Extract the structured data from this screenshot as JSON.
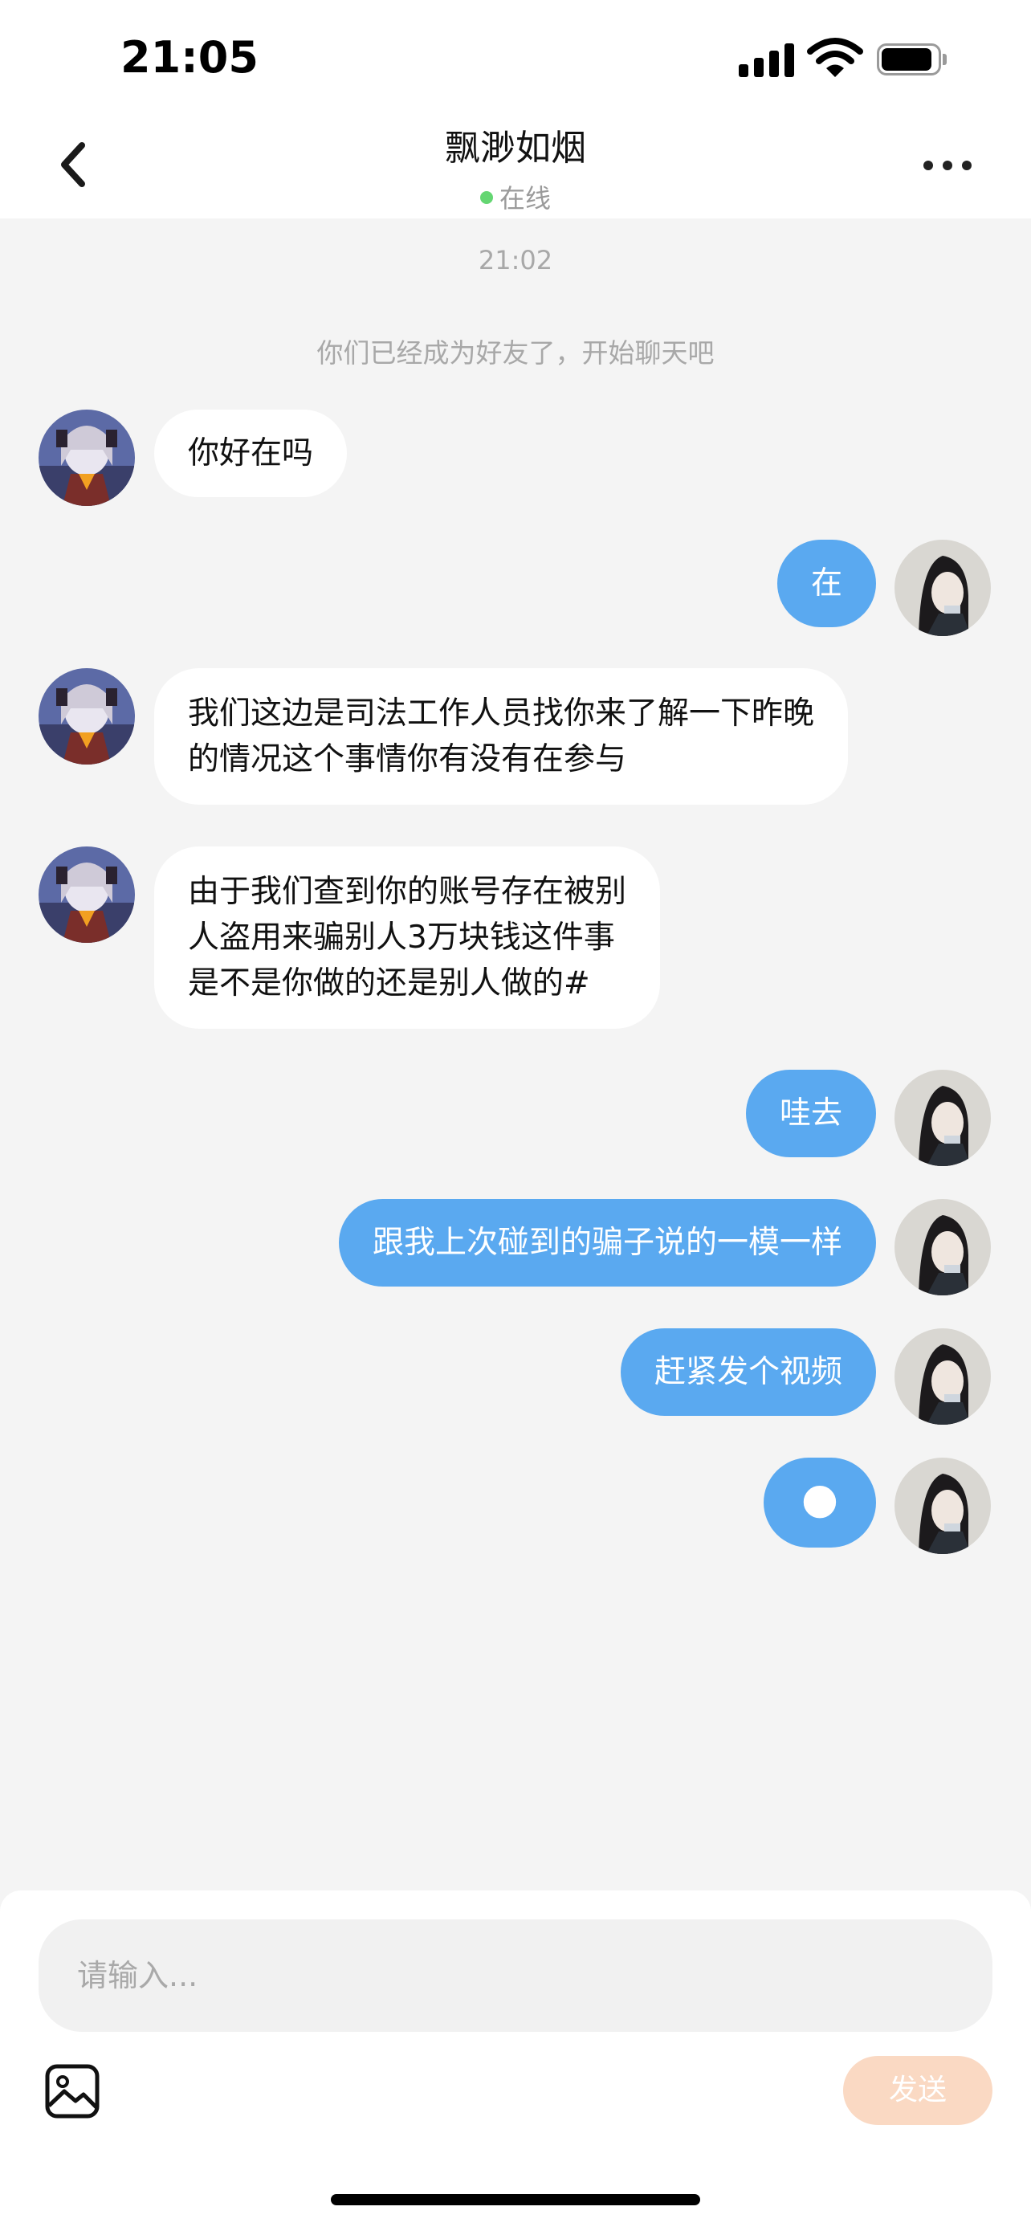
{
  "status_bar": {
    "time": "21:05"
  },
  "header": {
    "title": "飘渺如烟",
    "status": "在线"
  },
  "chat": {
    "timestamp": "21:02",
    "system_message": "你们已经成为好友了，开始聊天吧",
    "messages": [
      {
        "from": "them",
        "text": "你好在吗"
      },
      {
        "from": "me",
        "text": "在"
      },
      {
        "from": "them",
        "lines": [
          "我们这边是司法工作人员找你来了解一下昨晚",
          "的情况这个事情你有没有在参与"
        ]
      },
      {
        "from": "them",
        "lines": [
          "由于我们查到你的账号存在被别",
          "人盗用来骗别人3万块钱这件事",
          "是不是你做的还是别人做的#"
        ]
      },
      {
        "from": "me",
        "text": "哇去"
      },
      {
        "from": "me",
        "text": "跟我上次碰到的骗子说的一模一样"
      },
      {
        "from": "me",
        "text": "赶紧发个视频"
      },
      {
        "from": "me",
        "text": "🌑",
        "emoji": "new-moon-face"
      }
    ]
  },
  "composer": {
    "placeholder": "请输入...",
    "send_label": "发送"
  },
  "colors": {
    "outgoing_bubble": "#5aa9f0",
    "send_button": "#fad9c3",
    "online_dot": "#64d672"
  }
}
